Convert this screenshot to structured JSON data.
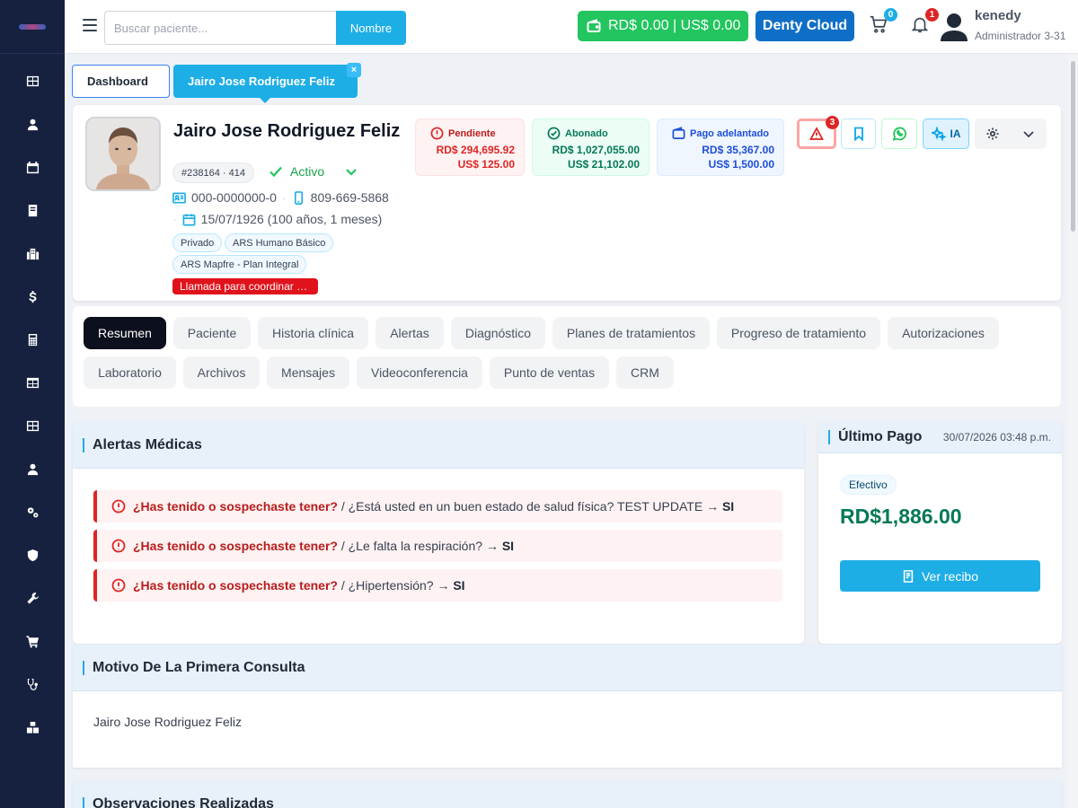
{
  "search": {
    "placeholder": "Buscar paciente...",
    "button": "Nombre"
  },
  "topbar": {
    "balance": "RD$ 0.00 | US$ 0.00",
    "brand": "Denty Cloud",
    "cart_count": "0",
    "notif_count": "1",
    "user_name": "kenedy",
    "user_role": "Administrador 3-31"
  },
  "tabs": {
    "dashboard": "Dashboard",
    "patient": "Jairo Jose Rodriguez Feliz",
    "close": "×"
  },
  "patient": {
    "name": "Jairo Jose Rodriguez Feliz",
    "id": "#238164 · 414",
    "status": "Activo",
    "document": "000-0000000-0",
    "phone": "809-669-5868",
    "birth": "15/07/1926 (100 años, 1 meses)",
    "chips": [
      "Privado",
      "ARS Humano Básico",
      "ARS Mapfre - Plan Integral"
    ],
    "note": "Llamada para coordinar …"
  },
  "finance": {
    "pending": {
      "label": "Pendiente",
      "rd": "RD$ 294,695.92",
      "us": "US$ 125.00"
    },
    "paid": {
      "label": "Abonado",
      "rd": "RD$ 1,027,055.00",
      "us": "US$ 21,102.00"
    },
    "advance": {
      "label": "Pago adelantado",
      "rd": "RD$ 35,367.00",
      "us": "US$ 1,500.00"
    }
  },
  "actions": {
    "alert_count": "3",
    "ia": "IA"
  },
  "section_tabs": [
    "Resumen",
    "Paciente",
    "Historia clínica",
    "Alertas",
    "Diagnóstico",
    "Planes de tratamientos",
    "Progreso de tratamiento",
    "Autorizaciones",
    "Laboratorio",
    "Archivos",
    "Mensajes",
    "Videoconferencia",
    "Punto de ventas",
    "CRM"
  ],
  "alerts_panel": {
    "title": "Alertas Médicas",
    "items": [
      {
        "q": "¿Has tenido o sospechaste tener?",
        "d": " / ¿Está usted en un buen estado de salud física? TEST UPDATE",
        "arrow": "→",
        "a": "SI"
      },
      {
        "q": "¿Has tenido o sospechaste tener?",
        "d": " / ¿Le falta la respiración?",
        "arrow": "→",
        "a": "SI"
      },
      {
        "q": "¿Has tenido o sospechaste tener?",
        "d": " / ¿Hipertensión?",
        "arrow": "→",
        "a": "SI"
      }
    ]
  },
  "last_payment": {
    "title": "Último Pago",
    "date": "30/07/2026 03:48 p.m.",
    "method": "Efectivo",
    "amount": "RD$1,886.00",
    "button": "Ver recibo"
  },
  "motivo": {
    "title": "Motivo De La Primera Consulta",
    "text": "Jairo Jose Rodriguez Feliz"
  },
  "observaciones": {
    "title": "Observaciones Realizadas"
  },
  "colors": {
    "accent": "#1eaee6",
    "sidebar": "#16213f",
    "success": "#22c55e",
    "danger": "#dc2626",
    "brand": "#0f6fc7"
  }
}
